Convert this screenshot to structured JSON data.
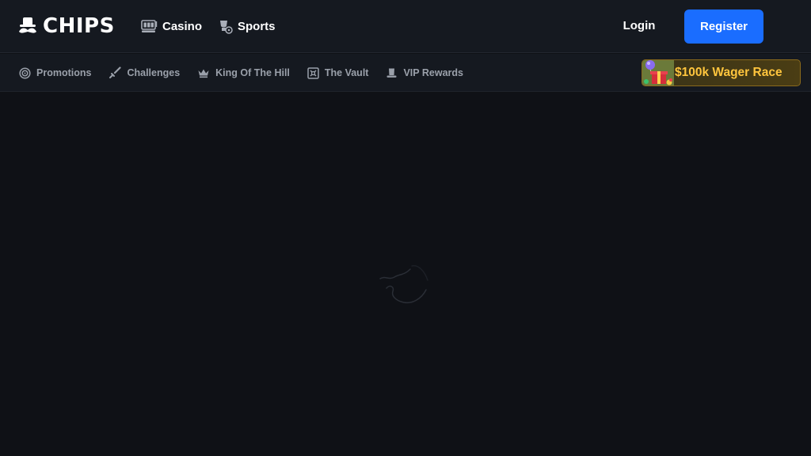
{
  "brand": {
    "name": "CHIPS",
    "icon": "mustache-hat-logo"
  },
  "header": {
    "nav": [
      {
        "label": "Casino",
        "icon": "slot-machine-icon"
      },
      {
        "label": "Sports",
        "icon": "sports-icon"
      }
    ],
    "login_label": "Login",
    "register_label": "Register"
  },
  "subnav": {
    "items": [
      {
        "label": "Promotions",
        "icon": "target-icon"
      },
      {
        "label": "Challenges",
        "icon": "sword-icon"
      },
      {
        "label": "King Of The Hill",
        "icon": "crown-icon"
      },
      {
        "label": "The Vault",
        "icon": "vault-icon"
      },
      {
        "label": "VIP Rewards",
        "icon": "top-hat-icon"
      }
    ],
    "promo": {
      "label": "$100k Wager Race",
      "icon": "gift-balloon-icon"
    }
  },
  "colors": {
    "background": "#0f1116",
    "header": "#151920",
    "accent": "#1a6dff",
    "promo_text": "#ffc53d",
    "muted_text": "#9aa0aa"
  },
  "main": {
    "state": "loading",
    "icon": "loading-spinner-icon"
  }
}
